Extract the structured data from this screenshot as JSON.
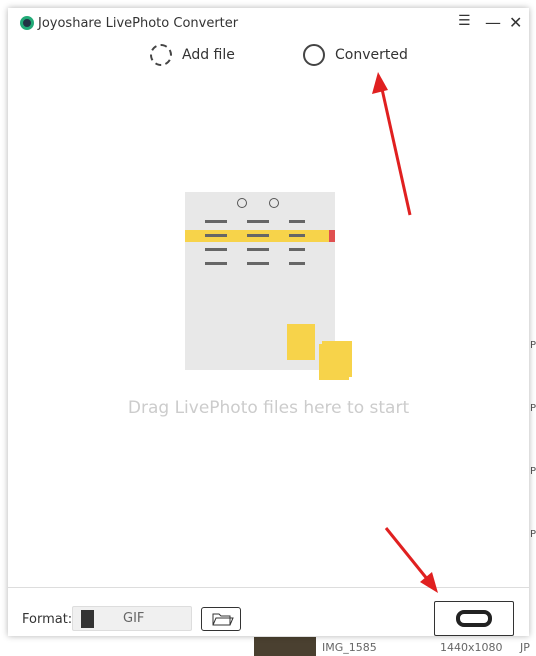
{
  "window": {
    "title": "Joyoshare LivePhoto Converter"
  },
  "tabs": [
    {
      "label": "Add file",
      "icon": "add-file-icon"
    },
    {
      "label": "Converted",
      "icon": "clock-icon"
    }
  ],
  "drop_area": {
    "hint": "Drag LivePhoto files here to start"
  },
  "footer": {
    "format_label": "Format:",
    "format_value": "GIF",
    "format_icon_text": "GIF"
  },
  "background": {
    "file_name": "IMG_1585",
    "resolution": "1440x1080",
    "type": "JP"
  },
  "colors": {
    "accent": "#f7d34a",
    "annotation": "#e02020"
  }
}
